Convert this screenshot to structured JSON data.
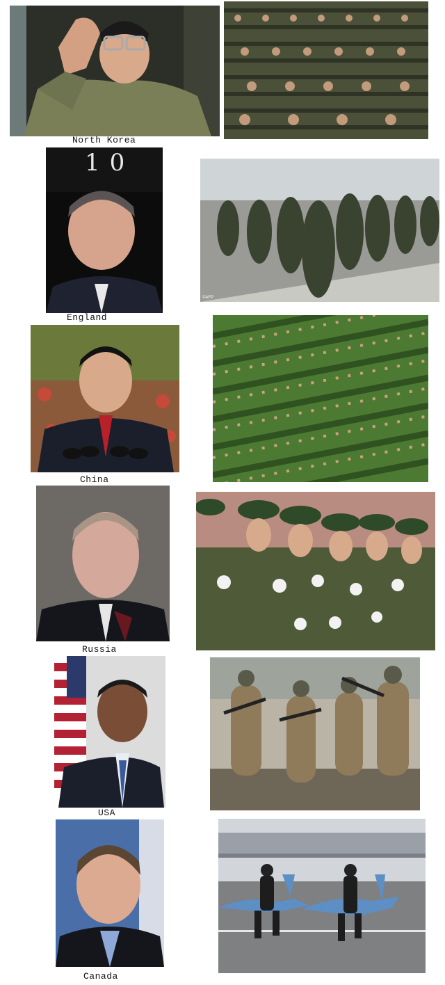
{
  "rows": [
    {
      "country": "North Korea"
    },
    {
      "country": "England"
    },
    {
      "country": "China"
    },
    {
      "country": "Russia"
    },
    {
      "country": "USA"
    },
    {
      "country": "Canada"
    }
  ],
  "england_door_number": "10",
  "afp_credit": "©AFP",
  "colors": {
    "background": "#ffffff",
    "olive_uniform": "#5a6a3a",
    "suit_dark": "#1c1f2a",
    "skin": "#d9a88a"
  }
}
